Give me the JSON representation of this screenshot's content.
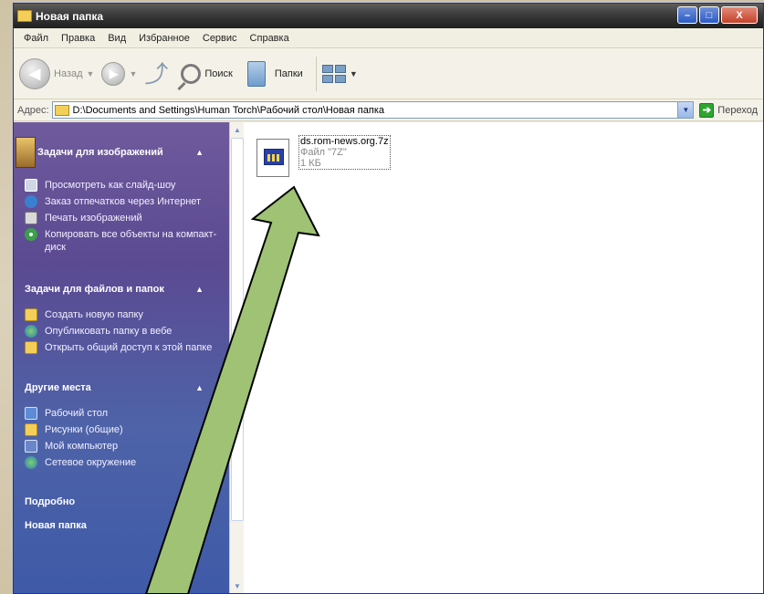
{
  "window": {
    "title": "Новая папка",
    "controls": {
      "minimize": "–",
      "maximize": "□",
      "close": "X"
    }
  },
  "menu": [
    "Файл",
    "Правка",
    "Вид",
    "Избранное",
    "Сервис",
    "Справка"
  ],
  "toolbar": {
    "back_label": "Назад",
    "search_label": "Поиск",
    "folders_label": "Папки"
  },
  "address": {
    "label": "Адрес:",
    "path": "D:\\Documents and Settings\\Human Torch\\Рабочий стол\\Новая папка",
    "go_label": "Переход"
  },
  "left_panel": {
    "image_tasks": {
      "title": "Задачи для изображений",
      "items": [
        {
          "label": "Просмотреть как слайд-шоу",
          "icon": "slideshow-icon"
        },
        {
          "label": "Заказ отпечатков через Интернет",
          "icon": "order-prints-icon"
        },
        {
          "label": "Печать изображений",
          "icon": "print-icon"
        },
        {
          "label": "Копировать все объекты на компакт-диск",
          "icon": "cd-icon"
        }
      ]
    },
    "file_tasks": {
      "title": "Задачи для файлов и папок",
      "items": [
        {
          "label": "Создать новую папку",
          "icon": "new-folder-icon"
        },
        {
          "label": "Опубликовать папку в вебе",
          "icon": "publish-web-icon"
        },
        {
          "label": "Открыть общий доступ к этой папке",
          "icon": "share-folder-icon"
        }
      ]
    },
    "other_places": {
      "title": "Другие места",
      "items": [
        {
          "label": "Рабочий стол",
          "icon": "desktop-icon"
        },
        {
          "label": "Рисунки (общие)",
          "icon": "shared-pictures-icon"
        },
        {
          "label": "Мой компьютер",
          "icon": "my-computer-icon"
        },
        {
          "label": "Сетевое окружение",
          "icon": "network-icon"
        }
      ]
    },
    "details": {
      "title": "Подробно",
      "name": "Новая папка"
    }
  },
  "file": {
    "name": "ds.rom-news.org.7z",
    "type": "Файл \"7Z\"",
    "size": "1 КБ"
  },
  "colors": {
    "title_bar": "#3a3a3a",
    "left_panel": "#5b4a92",
    "arrow_fill": "#9fc275"
  }
}
